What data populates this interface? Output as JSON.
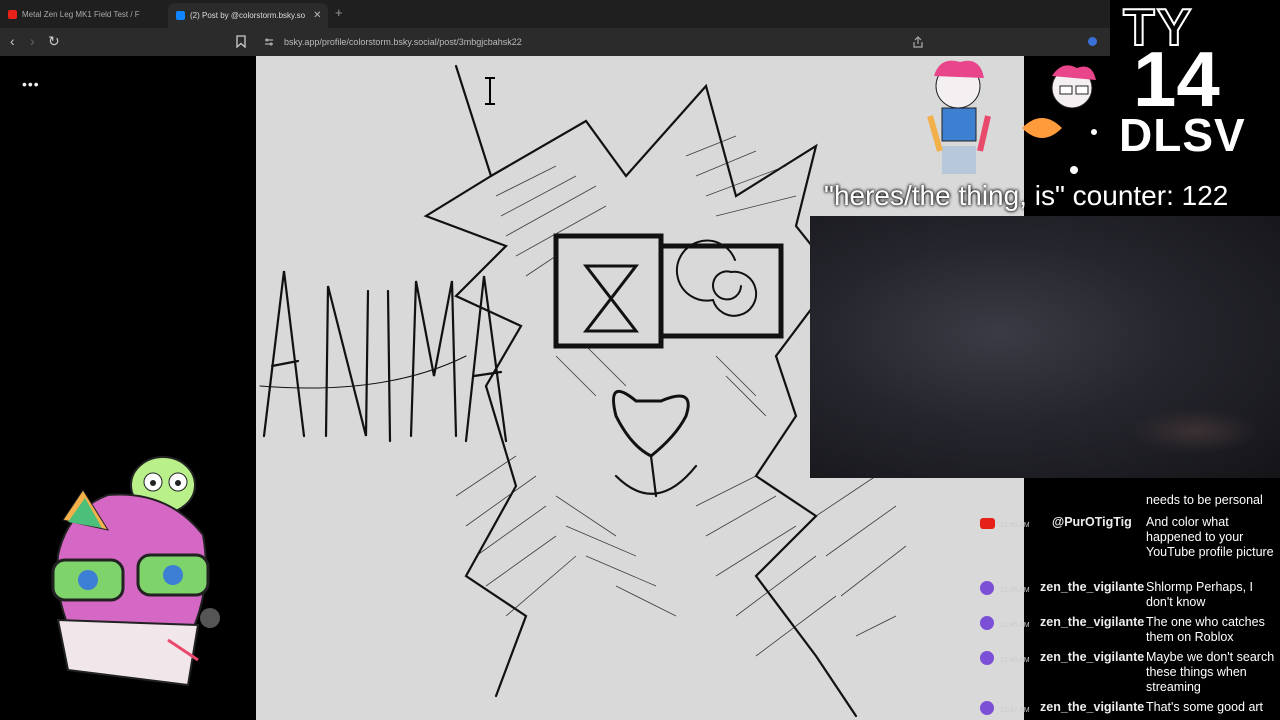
{
  "browser": {
    "tabs": [
      {
        "title": "Metal Zen Leg MK1 Field Test / F",
        "favicon_color": "#e62117"
      },
      {
        "title": "(2) Post by @colorstorm.bsky.so",
        "favicon_color": "#1185fe"
      }
    ],
    "new_tab_glyph": "+",
    "url": "bsky.app/profile/colorstorm.bsky.social/post/3mbgjcbahsk22",
    "nav": {
      "back": "‹",
      "forward": "›",
      "reload": "↻"
    }
  },
  "sidebar": {
    "menu_glyph": "•••"
  },
  "drawing": {
    "text": "ANIMA"
  },
  "overlay": {
    "logo": {
      "line1": "TY",
      "line2": "14",
      "line3": "DLSV"
    },
    "counter": "\"heres/the thing, is\" counter: 122"
  },
  "chat": {
    "messages": [
      {
        "platform": "",
        "time": "",
        "user": "",
        "text": "needs to be personal"
      },
      {
        "platform": "youtube",
        "time": "12:45 AM",
        "user": "@PurOTigTig",
        "text": "And color what happened to your YouTube profile picture"
      },
      {
        "platform": "twitch",
        "time": "12:45 AM",
        "user": "zen_the_vigilante",
        "text": "Shlormp Perhaps, I don't know"
      },
      {
        "platform": "twitch",
        "time": "12:45 AM",
        "user": "zen_the_vigilante",
        "text": "The one who catches them on Roblox"
      },
      {
        "platform": "twitch",
        "time": "12:46 AM",
        "user": "zen_the_vigilante",
        "text": "Maybe we don't search these things when streaming"
      },
      {
        "platform": "twitch",
        "time": "12:47 AM",
        "user": "zen_the_vigilante",
        "text": "That's some good art"
      }
    ]
  },
  "colors": {
    "youtube": "#e62117",
    "twitch": "#7b4fd6",
    "canvas": "#d9d9d9"
  }
}
